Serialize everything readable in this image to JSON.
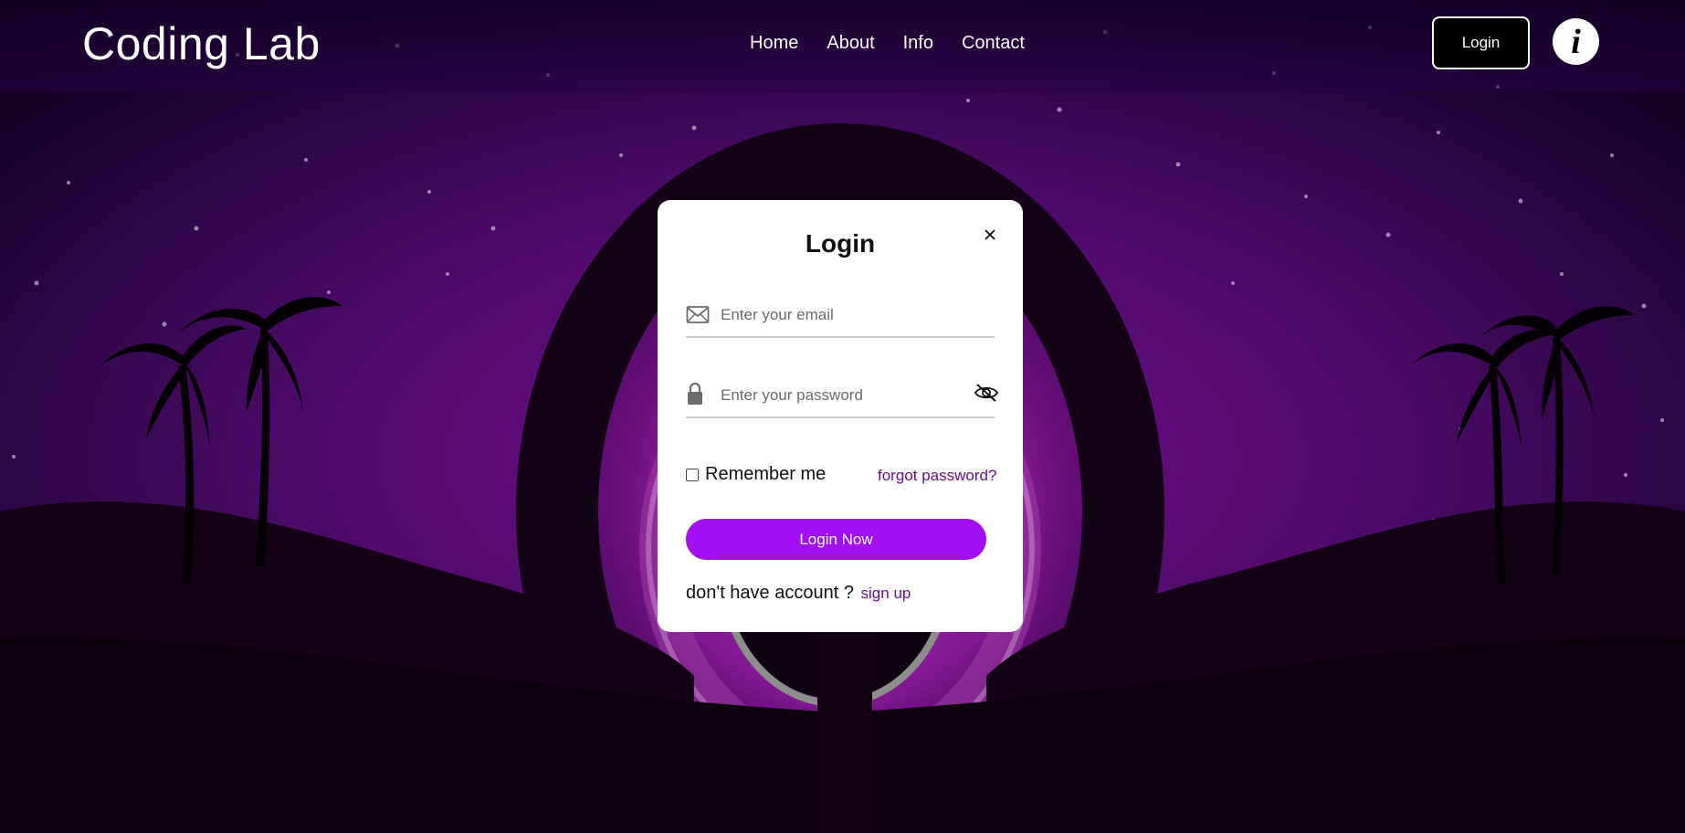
{
  "brand": {
    "name": "Coding Lab"
  },
  "nav": {
    "items": [
      {
        "label": "Home"
      },
      {
        "label": "About"
      },
      {
        "label": "Info"
      },
      {
        "label": "Contact"
      }
    ],
    "login_label": "Login",
    "info_label": "i"
  },
  "modal": {
    "title": "Login",
    "email_placeholder": "Enter your email",
    "password_placeholder": "Enter your password",
    "remember_label": "Remember me",
    "remember_checked": false,
    "forgot_label": "forgot password?",
    "submit_label": "Login Now",
    "signup_prompt": "don't have account ?",
    "signup_label": "sign up"
  },
  "icons": {
    "email": "envelope-icon",
    "password": "lock-icon",
    "toggle_password": "eye-slash-icon",
    "close": "close-icon"
  },
  "colors": {
    "accent": "#a30ff2",
    "link": "#6a0d91",
    "background": "#0d000f"
  }
}
